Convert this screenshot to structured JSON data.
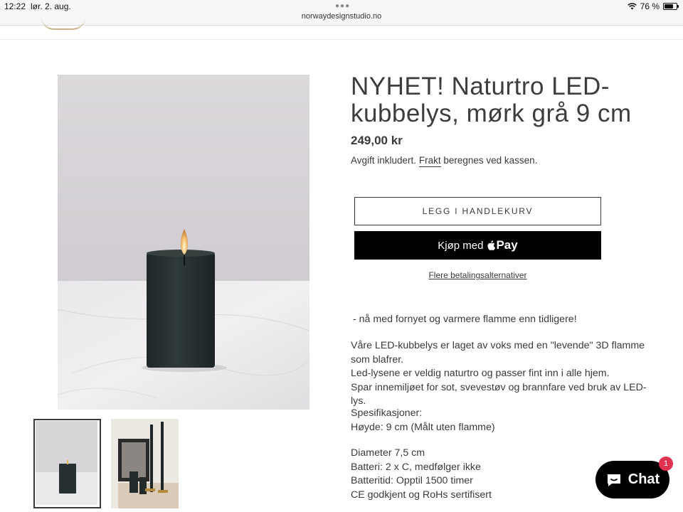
{
  "status_bar": {
    "time": "12:22",
    "date": "lør. 2. aug.",
    "url": "norwaydesignstudio.no",
    "battery": "76 %",
    "battery_level": 0.76
  },
  "product": {
    "title": "NYHET! Naturtro LED-kubbelys, mørk grå 9 cm",
    "price": "249,00 kr",
    "tax_prefix": "Avgift inkludert.",
    "tax_link": "Frakt",
    "tax_suffix": "beregnes ved kassen.",
    "add_to_cart_label": "LEGG I HANDLEKURV",
    "buy_with_label": "Kjøp med",
    "apple_pay_label": "Pay",
    "more_payment_label": "Flere betalingsalternativer"
  },
  "description": {
    "intro": "- nå med fornyet og varmere flamme enn tidligere!",
    "para1_line1": "Våre LED-kubbelys er laget av voks med en \"levende\" 3D flamme som blafrer.",
    "para1_line2": "Led-lysene er veldig naturtro og passer fint inn i alle hjem.",
    "para1_line3": "Spar innemiljøet for sot, svevestøv og brannfare ved bruk av LED-lys.",
    "spec_heading": "Spesifikasjoner:",
    "spec_height": "Høyde: 9 cm (Målt uten flamme)",
    "spec_diameter": "Diameter 7,5 cm",
    "spec_battery": "Batteri: 2 x C, medfølger ikke",
    "spec_battery_time": "Batteritid:  Opptil 1500 timer",
    "spec_cert": "CE godkjent og RoHs sertifisert"
  },
  "chat": {
    "label": "Chat",
    "badge": "1"
  },
  "colors": {
    "candle": "#2b3536",
    "background_wall": "#d9d6da",
    "badge": "#e0314e",
    "accent_black": "#000000"
  }
}
